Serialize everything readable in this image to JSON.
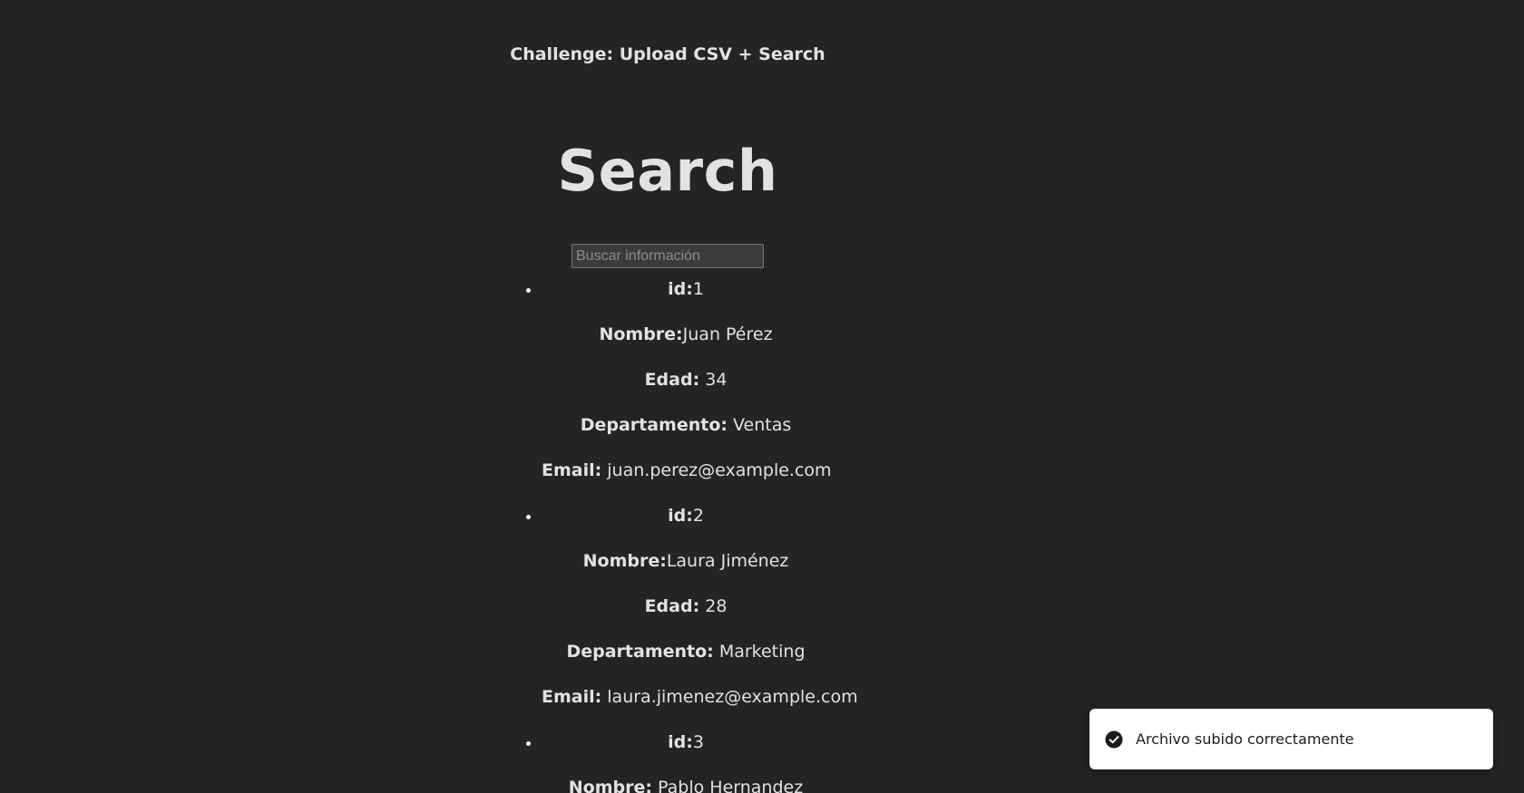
{
  "header": {
    "challenge_title": "Challenge: Upload CSV + Search",
    "heading": "Search"
  },
  "search": {
    "placeholder": "Buscar información",
    "value": ""
  },
  "records": [
    {
      "id_label": "id:",
      "id": "1",
      "nombre_label": "Nombre:",
      "nombre": "Juan Pérez",
      "edad_label": "Edad:",
      "edad": " 34",
      "departamento_label": "Departamento:",
      "departamento": " Ventas",
      "email_label": "Email:",
      "email": " juan.perez@example.com"
    },
    {
      "id_label": "id:",
      "id": "2",
      "nombre_label": "Nombre:",
      "nombre": "Laura Jiménez",
      "edad_label": "Edad:",
      "edad": " 28",
      "departamento_label": "Departamento:",
      "departamento": " Marketing",
      "email_label": "Email:",
      "email": " laura.jimenez@example.com"
    },
    {
      "id_label": "id:",
      "id": "3",
      "nombre_label": "Nombre:",
      "nombre": " Pablo Hernandez"
    }
  ],
  "toast": {
    "icon": "check-circle-icon",
    "message": "Archivo subido correctamente"
  },
  "colors": {
    "background": "#242424",
    "text": "#dedede",
    "toast_background": "#ffffff",
    "toast_text": "#1c1c1c"
  }
}
